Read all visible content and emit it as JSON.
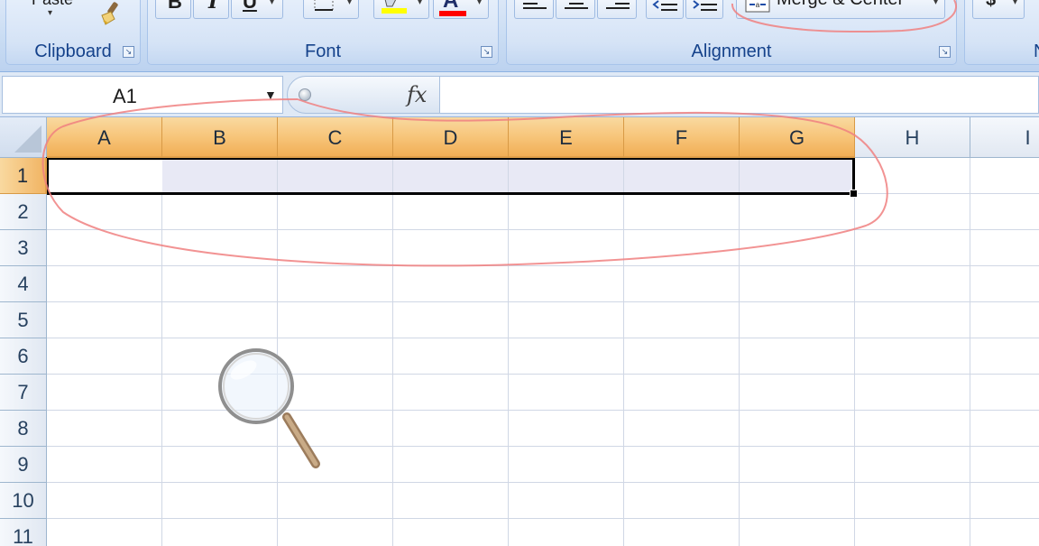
{
  "ribbon": {
    "clipboard": {
      "label": "Clipboard",
      "paste_label": "Paste"
    },
    "font": {
      "label": "Font",
      "bold": "B",
      "italic": "I",
      "underline": "U",
      "font_color_glyph": "A"
    },
    "alignment": {
      "label": "Alignment",
      "merge_center_label": "Merge & Center"
    },
    "number": {
      "label": "N",
      "currency_symbol": "$"
    }
  },
  "formula_bar": {
    "name_box_value": "A1",
    "fx_label": "fx",
    "formula_value": ""
  },
  "grid": {
    "columns": [
      "A",
      "B",
      "C",
      "D",
      "E",
      "F",
      "G",
      "H",
      "I"
    ],
    "selected_columns": [
      "A",
      "B",
      "C",
      "D",
      "E",
      "F",
      "G"
    ],
    "rows": [
      "1",
      "2",
      "3",
      "4",
      "5",
      "6",
      "7",
      "8",
      "9",
      "10",
      "11"
    ],
    "selected_row": "1",
    "active_cell": "A1",
    "selected_range": "A1:G1"
  },
  "colors": {
    "selected_header": "#f7c57a",
    "annotation": "#f08080",
    "ribbon_text": "#15428b",
    "font_color_bar": "#ff0000",
    "highlight_bar": "#ffff00"
  },
  "icons": [
    "paste-brush-icon",
    "magnifier-icon",
    "merge-center-icon",
    "launcher-icon",
    "fx-icon"
  ]
}
